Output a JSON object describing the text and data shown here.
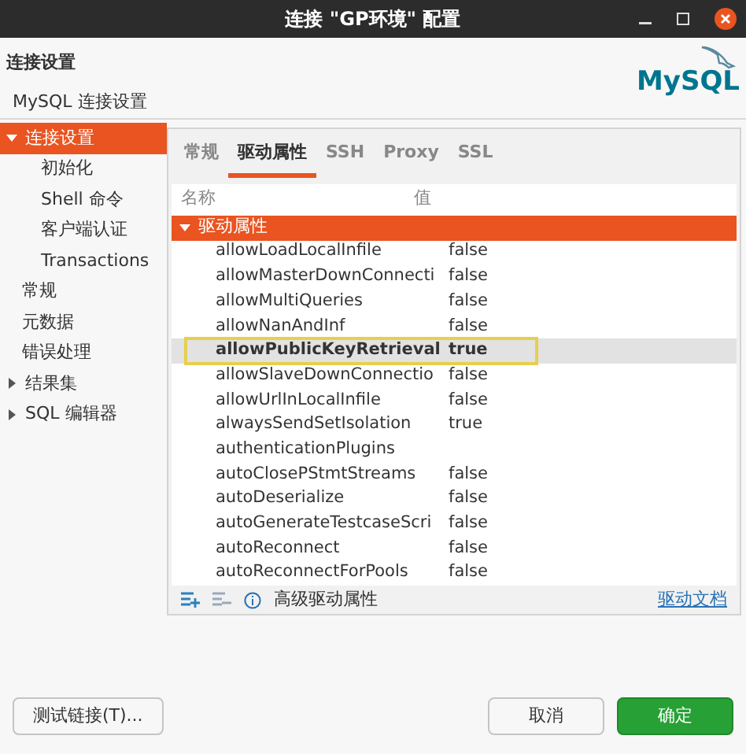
{
  "window": {
    "title": "连接 \"GP环境\" 配置"
  },
  "header": {
    "title": "连接设置",
    "subtitle": "MySQL 连接设置",
    "logo_text": "MySQL"
  },
  "sidebar": {
    "items": [
      {
        "label": "连接设置",
        "selected": true,
        "expanded": true,
        "children": [
          {
            "label": "初始化",
            "selected": false
          },
          {
            "label": "Shell 命令",
            "selected": false
          },
          {
            "label": "客户端认证",
            "selected": false
          },
          {
            "label": "Transactions",
            "selected": false
          }
        ]
      },
      {
        "label": "常规",
        "selected": false
      },
      {
        "label": "元数据",
        "selected": false
      },
      {
        "label": "错误处理",
        "selected": false
      },
      {
        "label": "结果集",
        "selected": false,
        "expanded": false
      },
      {
        "label": "SQL 编辑器",
        "selected": false,
        "expanded": false
      }
    ]
  },
  "tabs": [
    {
      "label": "常规",
      "selected": false
    },
    {
      "label": "驱动属性",
      "selected": true
    },
    {
      "label": "SSH",
      "selected": false
    },
    {
      "label": "Proxy",
      "selected": false
    },
    {
      "label": "SSL",
      "selected": false
    }
  ],
  "table": {
    "columns": [
      "名称",
      "值"
    ],
    "group": {
      "label": "驱动属性",
      "expanded": true
    },
    "rows": [
      {
        "name": "allowLoadLocalInfile",
        "value": "false",
        "selected": false
      },
      {
        "name": "allowMasterDownConnecti",
        "value": "false",
        "selected": false
      },
      {
        "name": "allowMultiQueries",
        "value": "false",
        "selected": false
      },
      {
        "name": "allowNanAndInf",
        "value": "false",
        "selected": false
      },
      {
        "name": "allowPublicKeyRetrieval",
        "value": "true",
        "selected": true
      },
      {
        "name": "allowSlaveDownConnectio",
        "value": "false",
        "selected": false
      },
      {
        "name": "allowUrlInLocalInfile",
        "value": "false",
        "selected": false
      },
      {
        "name": "alwaysSendSetIsolation",
        "value": "true",
        "selected": false
      },
      {
        "name": "authenticationPlugins",
        "selected": false
      },
      {
        "name": "autoClosePStmtStreams",
        "value": "false",
        "selected": false
      },
      {
        "name": "autoDeserialize",
        "value": "false",
        "selected": false
      },
      {
        "name": "autoGenerateTestcaseScri",
        "value": "false",
        "selected": false
      },
      {
        "name": "autoReconnect",
        "value": "false",
        "selected": false
      },
      {
        "name": "autoReconnectForPools",
        "value": "false",
        "selected": false
      }
    ]
  },
  "toolbar": {
    "label": "高级驱动属性",
    "link": "驱动文档"
  },
  "buttons": [
    {
      "label": "测试链接(T)...",
      "kind": "default"
    },
    {
      "label": "取消",
      "kind": "default"
    },
    {
      "label": "确定",
      "kind": "primary"
    }
  ]
}
